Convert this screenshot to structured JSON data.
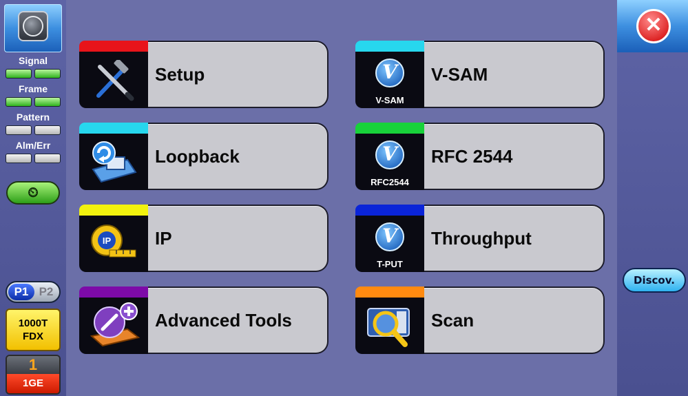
{
  "left_panel": {
    "indicators": [
      {
        "label": "Signal",
        "state": [
          "green",
          "green"
        ]
      },
      {
        "label": "Frame",
        "state": [
          "green",
          "green"
        ]
      },
      {
        "label": "Pattern",
        "state": [
          "gray",
          "gray"
        ]
      },
      {
        "label": "Alm/Err",
        "state": [
          "gray",
          "gray"
        ]
      }
    ],
    "history_icon": "⏲",
    "port_p1": "P1",
    "port_p2": "P2",
    "link_line1": "1000T",
    "link_line2": "FDX",
    "port_number": "1",
    "port_type": "1GE"
  },
  "tiles": [
    {
      "label": "Setup",
      "bar_color": "#e8141a",
      "icon": "tools-icon",
      "caption": ""
    },
    {
      "label": "V-SAM",
      "bar_color": "#27d7ee",
      "icon": "vsam-icon",
      "caption": "V-SAM"
    },
    {
      "label": "Loopback",
      "bar_color": "#27d7ee",
      "icon": "loopback-icon",
      "caption": ""
    },
    {
      "label": "RFC 2544",
      "bar_color": "#18d23a",
      "icon": "rfc2544-icon",
      "caption": "RFC2544"
    },
    {
      "label": "IP",
      "bar_color": "#f2f20e",
      "icon": "ip-tape-icon",
      "caption": ""
    },
    {
      "label": "Throughput",
      "bar_color": "#0a24d8",
      "icon": "throughput-icon",
      "caption": "T-PUT"
    },
    {
      "label": "Advanced Tools",
      "bar_color": "#7d0aa8",
      "icon": "advanced-tools-icon",
      "caption": ""
    },
    {
      "label": "Scan",
      "bar_color": "#ff8a10",
      "icon": "scan-icon",
      "caption": ""
    }
  ],
  "right_panel": {
    "close_glyph": "✕",
    "discover_label": "Discov."
  }
}
